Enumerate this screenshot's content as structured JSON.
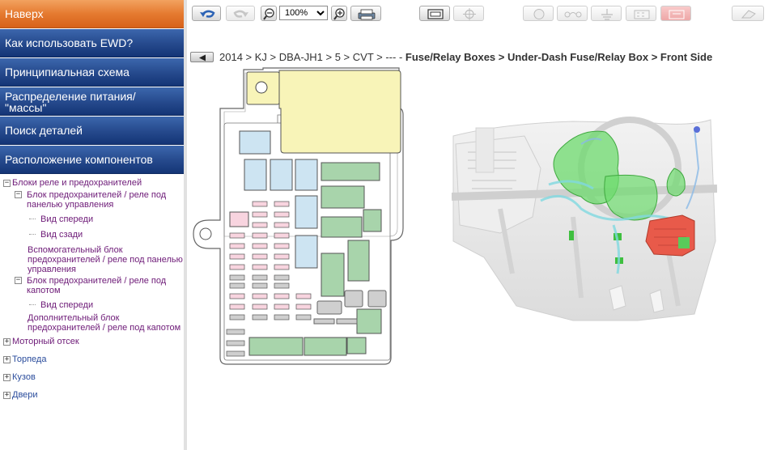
{
  "sidebar": {
    "nav": [
      {
        "label": "Наверх",
        "active": true
      },
      {
        "label": "Как использовать EWD?"
      },
      {
        "label": "Принципиальная схема"
      },
      {
        "label": "Распределение питания/ \"массы\""
      },
      {
        "label": "Поиск деталей"
      },
      {
        "label": "Расположение компонентов"
      }
    ],
    "tree": {
      "root": "Блоки реле и предохранителей",
      "under_dash": "Блок предохранителей / реле под панелью управления",
      "under_dash_front": "Вид спереди",
      "under_dash_rear": "Вид сзади",
      "aux_under_dash": "Вспомогательный блок предохранителей / реле под панелью управления",
      "hood": "Блок предохранителей / реле под капотом",
      "hood_front": "Вид спереди",
      "aux_hood": "Дополнительный блок предохранителей / реле под капотом",
      "engine": "Моторный отсек",
      "dash": "Торпеда",
      "body": "Кузов",
      "doors": "Двери"
    }
  },
  "toolbar": {
    "zoom_value": "100%",
    "zoom_options": [
      "100%"
    ]
  },
  "breadcrumb": {
    "path_plain": "2014 > KJ > DBA-JH1 > 5 > CVT > --- - ",
    "path_bold": "Fuse/Relay Boxes > Under-Dash Fuse/Relay Box > Front Side"
  },
  "colors": {
    "nav_blue": "#25498c",
    "nav_orange": "#e57a30",
    "fuse_yellow": "#f8f4b8",
    "relay_green": "#a8d4ab",
    "fuse_blue": "#cde4f2",
    "fuse_pink": "#f8d4df",
    "fuse_gray": "#cfcfcf",
    "highlight_red": "#e85a4a",
    "highlight_green": "#6ddb6d"
  },
  "icons": {
    "back": "back-arrow-icon",
    "forward": "forward-arrow-icon",
    "zoom_out": "zoom-out-icon",
    "zoom_in": "zoom-in-icon",
    "print": "print-icon",
    "fit": "fit-screen-icon",
    "target": "target-icon",
    "connector": "connector-icon",
    "wire": "wire-icon",
    "ground": "ground-icon",
    "component": "component-icon",
    "relay": "relay-icon",
    "eraser": "eraser-icon"
  }
}
